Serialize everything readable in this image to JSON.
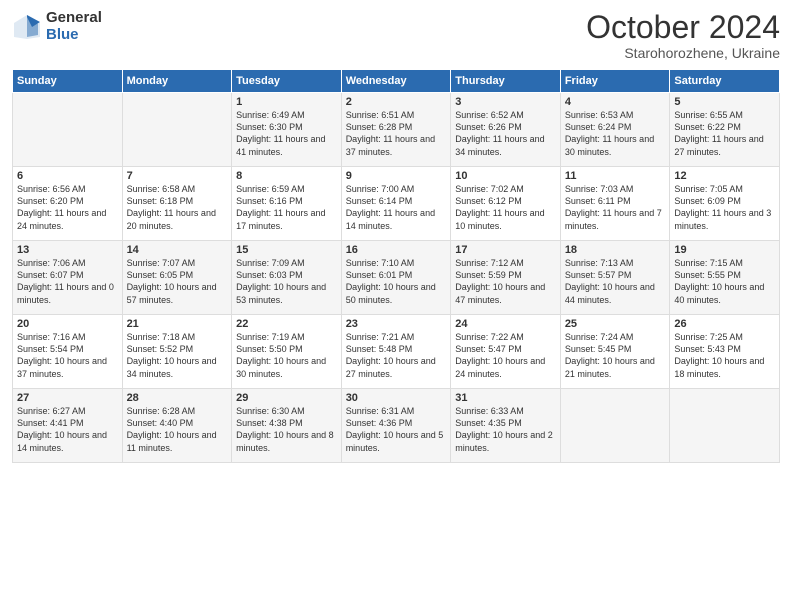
{
  "logo": {
    "general": "General",
    "blue": "Blue"
  },
  "title": "October 2024",
  "subtitle": "Starohorozhene, Ukraine",
  "days_header": [
    "Sunday",
    "Monday",
    "Tuesday",
    "Wednesday",
    "Thursday",
    "Friday",
    "Saturday"
  ],
  "weeks": [
    [
      {
        "day": "",
        "info": ""
      },
      {
        "day": "",
        "info": ""
      },
      {
        "day": "1",
        "info": "Sunrise: 6:49 AM\nSunset: 6:30 PM\nDaylight: 11 hours and 41 minutes."
      },
      {
        "day": "2",
        "info": "Sunrise: 6:51 AM\nSunset: 6:28 PM\nDaylight: 11 hours and 37 minutes."
      },
      {
        "day": "3",
        "info": "Sunrise: 6:52 AM\nSunset: 6:26 PM\nDaylight: 11 hours and 34 minutes."
      },
      {
        "day": "4",
        "info": "Sunrise: 6:53 AM\nSunset: 6:24 PM\nDaylight: 11 hours and 30 minutes."
      },
      {
        "day": "5",
        "info": "Sunrise: 6:55 AM\nSunset: 6:22 PM\nDaylight: 11 hours and 27 minutes."
      }
    ],
    [
      {
        "day": "6",
        "info": "Sunrise: 6:56 AM\nSunset: 6:20 PM\nDaylight: 11 hours and 24 minutes."
      },
      {
        "day": "7",
        "info": "Sunrise: 6:58 AM\nSunset: 6:18 PM\nDaylight: 11 hours and 20 minutes."
      },
      {
        "day": "8",
        "info": "Sunrise: 6:59 AM\nSunset: 6:16 PM\nDaylight: 11 hours and 17 minutes."
      },
      {
        "day": "9",
        "info": "Sunrise: 7:00 AM\nSunset: 6:14 PM\nDaylight: 11 hours and 14 minutes."
      },
      {
        "day": "10",
        "info": "Sunrise: 7:02 AM\nSunset: 6:12 PM\nDaylight: 11 hours and 10 minutes."
      },
      {
        "day": "11",
        "info": "Sunrise: 7:03 AM\nSunset: 6:11 PM\nDaylight: 11 hours and 7 minutes."
      },
      {
        "day": "12",
        "info": "Sunrise: 7:05 AM\nSunset: 6:09 PM\nDaylight: 11 hours and 3 minutes."
      }
    ],
    [
      {
        "day": "13",
        "info": "Sunrise: 7:06 AM\nSunset: 6:07 PM\nDaylight: 11 hours and 0 minutes."
      },
      {
        "day": "14",
        "info": "Sunrise: 7:07 AM\nSunset: 6:05 PM\nDaylight: 10 hours and 57 minutes."
      },
      {
        "day": "15",
        "info": "Sunrise: 7:09 AM\nSunset: 6:03 PM\nDaylight: 10 hours and 53 minutes."
      },
      {
        "day": "16",
        "info": "Sunrise: 7:10 AM\nSunset: 6:01 PM\nDaylight: 10 hours and 50 minutes."
      },
      {
        "day": "17",
        "info": "Sunrise: 7:12 AM\nSunset: 5:59 PM\nDaylight: 10 hours and 47 minutes."
      },
      {
        "day": "18",
        "info": "Sunrise: 7:13 AM\nSunset: 5:57 PM\nDaylight: 10 hours and 44 minutes."
      },
      {
        "day": "19",
        "info": "Sunrise: 7:15 AM\nSunset: 5:55 PM\nDaylight: 10 hours and 40 minutes."
      }
    ],
    [
      {
        "day": "20",
        "info": "Sunrise: 7:16 AM\nSunset: 5:54 PM\nDaylight: 10 hours and 37 minutes."
      },
      {
        "day": "21",
        "info": "Sunrise: 7:18 AM\nSunset: 5:52 PM\nDaylight: 10 hours and 34 minutes."
      },
      {
        "day": "22",
        "info": "Sunrise: 7:19 AM\nSunset: 5:50 PM\nDaylight: 10 hours and 30 minutes."
      },
      {
        "day": "23",
        "info": "Sunrise: 7:21 AM\nSunset: 5:48 PM\nDaylight: 10 hours and 27 minutes."
      },
      {
        "day": "24",
        "info": "Sunrise: 7:22 AM\nSunset: 5:47 PM\nDaylight: 10 hours and 24 minutes."
      },
      {
        "day": "25",
        "info": "Sunrise: 7:24 AM\nSunset: 5:45 PM\nDaylight: 10 hours and 21 minutes."
      },
      {
        "day": "26",
        "info": "Sunrise: 7:25 AM\nSunset: 5:43 PM\nDaylight: 10 hours and 18 minutes."
      }
    ],
    [
      {
        "day": "27",
        "info": "Sunrise: 6:27 AM\nSunset: 4:41 PM\nDaylight: 10 hours and 14 minutes."
      },
      {
        "day": "28",
        "info": "Sunrise: 6:28 AM\nSunset: 4:40 PM\nDaylight: 10 hours and 11 minutes."
      },
      {
        "day": "29",
        "info": "Sunrise: 6:30 AM\nSunset: 4:38 PM\nDaylight: 10 hours and 8 minutes."
      },
      {
        "day": "30",
        "info": "Sunrise: 6:31 AM\nSunset: 4:36 PM\nDaylight: 10 hours and 5 minutes."
      },
      {
        "day": "31",
        "info": "Sunrise: 6:33 AM\nSunset: 4:35 PM\nDaylight: 10 hours and 2 minutes."
      },
      {
        "day": "",
        "info": ""
      },
      {
        "day": "",
        "info": ""
      }
    ]
  ]
}
